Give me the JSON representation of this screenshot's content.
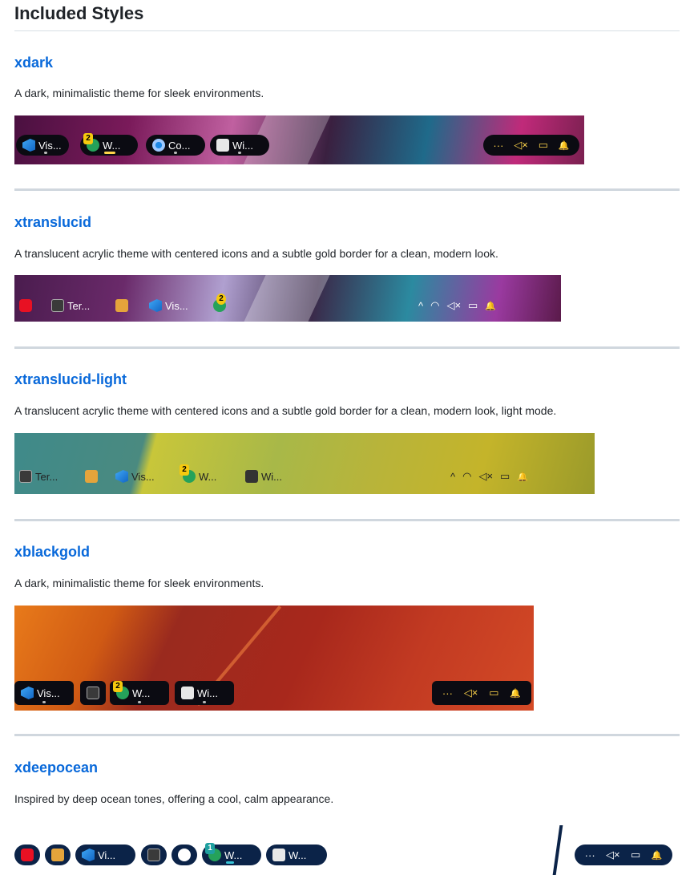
{
  "page": {
    "title": "Included Styles"
  },
  "styles": [
    {
      "name": "xdark",
      "description": "A dark, minimalistic theme for sleek environments.",
      "apps": [
        "Vis...",
        "W...",
        "Co...",
        "Wi..."
      ],
      "badge": "2",
      "tray": {
        "overflow": "···",
        "mute": "◁×",
        "battery": "▭",
        "bell": "🔔"
      }
    },
    {
      "name": "xtranslucid",
      "description": "A translucent acrylic theme with centered icons and a subtle gold border for a clean, modern look.",
      "apps": [
        "Ter...",
        "Vis..."
      ],
      "badge": "2",
      "tray": {
        "chevron": "^",
        "wifi": "◠",
        "mute": "◁×",
        "battery": "▭",
        "bell": "🔔"
      }
    },
    {
      "name": "xtranslucid-light",
      "description": "A translucent acrylic theme with centered icons and a subtle gold border for a clean, modern look, light mode.",
      "apps": [
        "Ter...",
        "Vis...",
        "W...",
        "Wi..."
      ],
      "badge": "2",
      "tray": {
        "chevron": "^",
        "wifi": "◠",
        "mute": "◁×",
        "battery": "▭",
        "bell": "🔔"
      }
    },
    {
      "name": "xblackgold",
      "description": "A dark, minimalistic theme for sleek environments.",
      "apps": [
        "Vis...",
        "W...",
        "Wi..."
      ],
      "badge": "2",
      "tray": {
        "overflow": "···",
        "mute": "◁×",
        "battery": "▭",
        "bell": "🔔"
      }
    },
    {
      "name": "xdeepocean",
      "description": "Inspired by deep ocean tones, offering a cool, calm appearance.",
      "apps": [
        "Vi...",
        "W...",
        "W..."
      ],
      "badge": "1",
      "tray": {
        "overflow": "···",
        "mute": "◁×",
        "battery": "▭",
        "bell": "🔔"
      }
    }
  ],
  "colors": {
    "link": "#0969da",
    "gold": "#ffd54a",
    "ocean": "#0b2348"
  }
}
